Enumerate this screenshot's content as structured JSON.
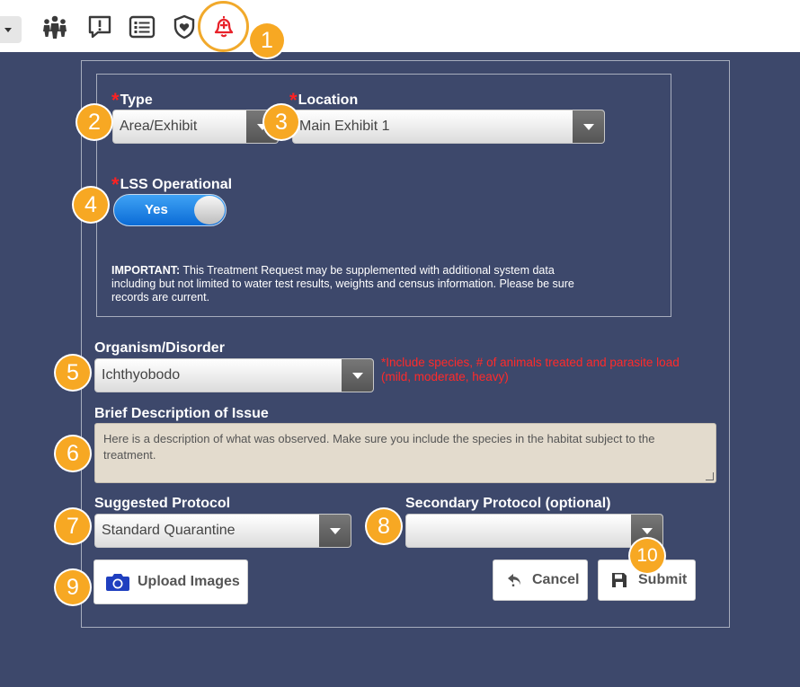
{
  "toolbar": {
    "icons": [
      "chevron-down-icon",
      "group-icon",
      "alert-chat-icon",
      "list-icon",
      "shield-heart-icon",
      "medical-bell-icon"
    ]
  },
  "callouts": [
    "1",
    "2",
    "3",
    "4",
    "5",
    "6",
    "7",
    "8",
    "9",
    "10"
  ],
  "form": {
    "type": {
      "required_mark": "*",
      "label": "Type",
      "value": "Area/Exhibit"
    },
    "location": {
      "required_mark": "*",
      "label": "Location",
      "value": "Main Exhibit 1"
    },
    "lss": {
      "required_mark": "*",
      "label": "LSS Operational",
      "value": "Yes"
    },
    "notice": {
      "strong": "IMPORTANT:",
      "text": " This Treatment Request may be supplemented with additional system data including but not limited to water test results, weights and census information. Please be sure records are current."
    },
    "organism": {
      "label": "Organism/Disorder",
      "value": "Ichthyobodo",
      "hint": "*Include species, # of animals treated and parasite load (mild, moderate, heavy)"
    },
    "description": {
      "label": "Brief Description of Issue",
      "value": "Here is a description of what was observed. Make sure you include the species in the habitat subject to the treatment."
    },
    "suggested_protocol": {
      "label": "Suggested Protocol",
      "value": "Standard Quarantine"
    },
    "secondary_protocol": {
      "label": "Secondary Protocol (optional)",
      "value": ""
    },
    "buttons": {
      "upload": "Upload Images",
      "cancel": "Cancel",
      "submit": "Submit"
    }
  },
  "colors": {
    "background": "#3d486b",
    "callout": "#f7a823",
    "required": "#ff2222",
    "hint": "#ff2a2a",
    "toggle_on": "#1a7de0",
    "bell": "#e8222a",
    "camera": "#1f3fbf"
  }
}
